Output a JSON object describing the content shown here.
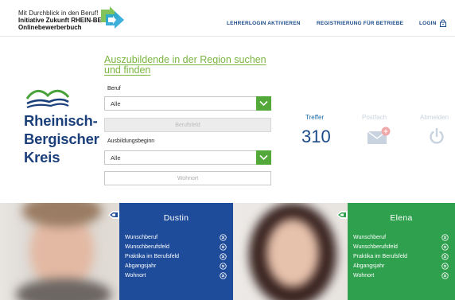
{
  "header": {
    "brand_line1": "Mit Durchblick in den Beruf!",
    "brand_line2": "Initiative Zukunft RHEIN-BERG",
    "brand_line3": "Onlinebewerberbuch",
    "nav": {
      "lehrerlogin": "LEHRERLOGIN AKTIVIEREN",
      "registrierung": "REGISTRIERUNG FÜR BETRIEBE",
      "login": "LOGIN"
    }
  },
  "kreis": {
    "line1": "Rheinisch-",
    "line2": "Bergischer",
    "line3": "Kreis"
  },
  "form": {
    "title": "Auszubildende in der Region suchen und finden",
    "beruf_label": "Beruf",
    "beruf_value": "Alle",
    "berufsfeld_placeholder": "Berufsfeld",
    "ausbildungsbeginn_label": "Ausbildungsbeginn",
    "ausbildungsbeginn_value": "Alle",
    "wohnort_placeholder": "Wohnort"
  },
  "stats": {
    "treffer_label": "Treffer",
    "treffer_count": "310",
    "postfach_label": "Postfach",
    "abmelden_label": "Abmelden"
  },
  "profiles": [
    {
      "name": "Dustin",
      "rows": [
        "Wunschberuf",
        "Wunschberufsfeld",
        "Praktika im Berufsfeld",
        "Abgangsjahr",
        "Wohnort"
      ]
    },
    {
      "name": "Elena",
      "rows": [
        "Wunschberuf",
        "Wunschberufsfeld",
        "Praktika im Berufsfeld",
        "Abgangsjahr",
        "Wohnort"
      ]
    }
  ],
  "colors": {
    "navy": "#1b3f7a",
    "green": "#52a838",
    "card_blue": "#1e4c9a",
    "card_green": "#2fa04e"
  },
  "icons": {
    "brand": "hand-arrow-logo-icon",
    "lock": "lock-icon",
    "mail": "mail-icon",
    "power": "power-icon",
    "chevron": "chevron-down-icon",
    "remove": "circle-x-icon"
  }
}
